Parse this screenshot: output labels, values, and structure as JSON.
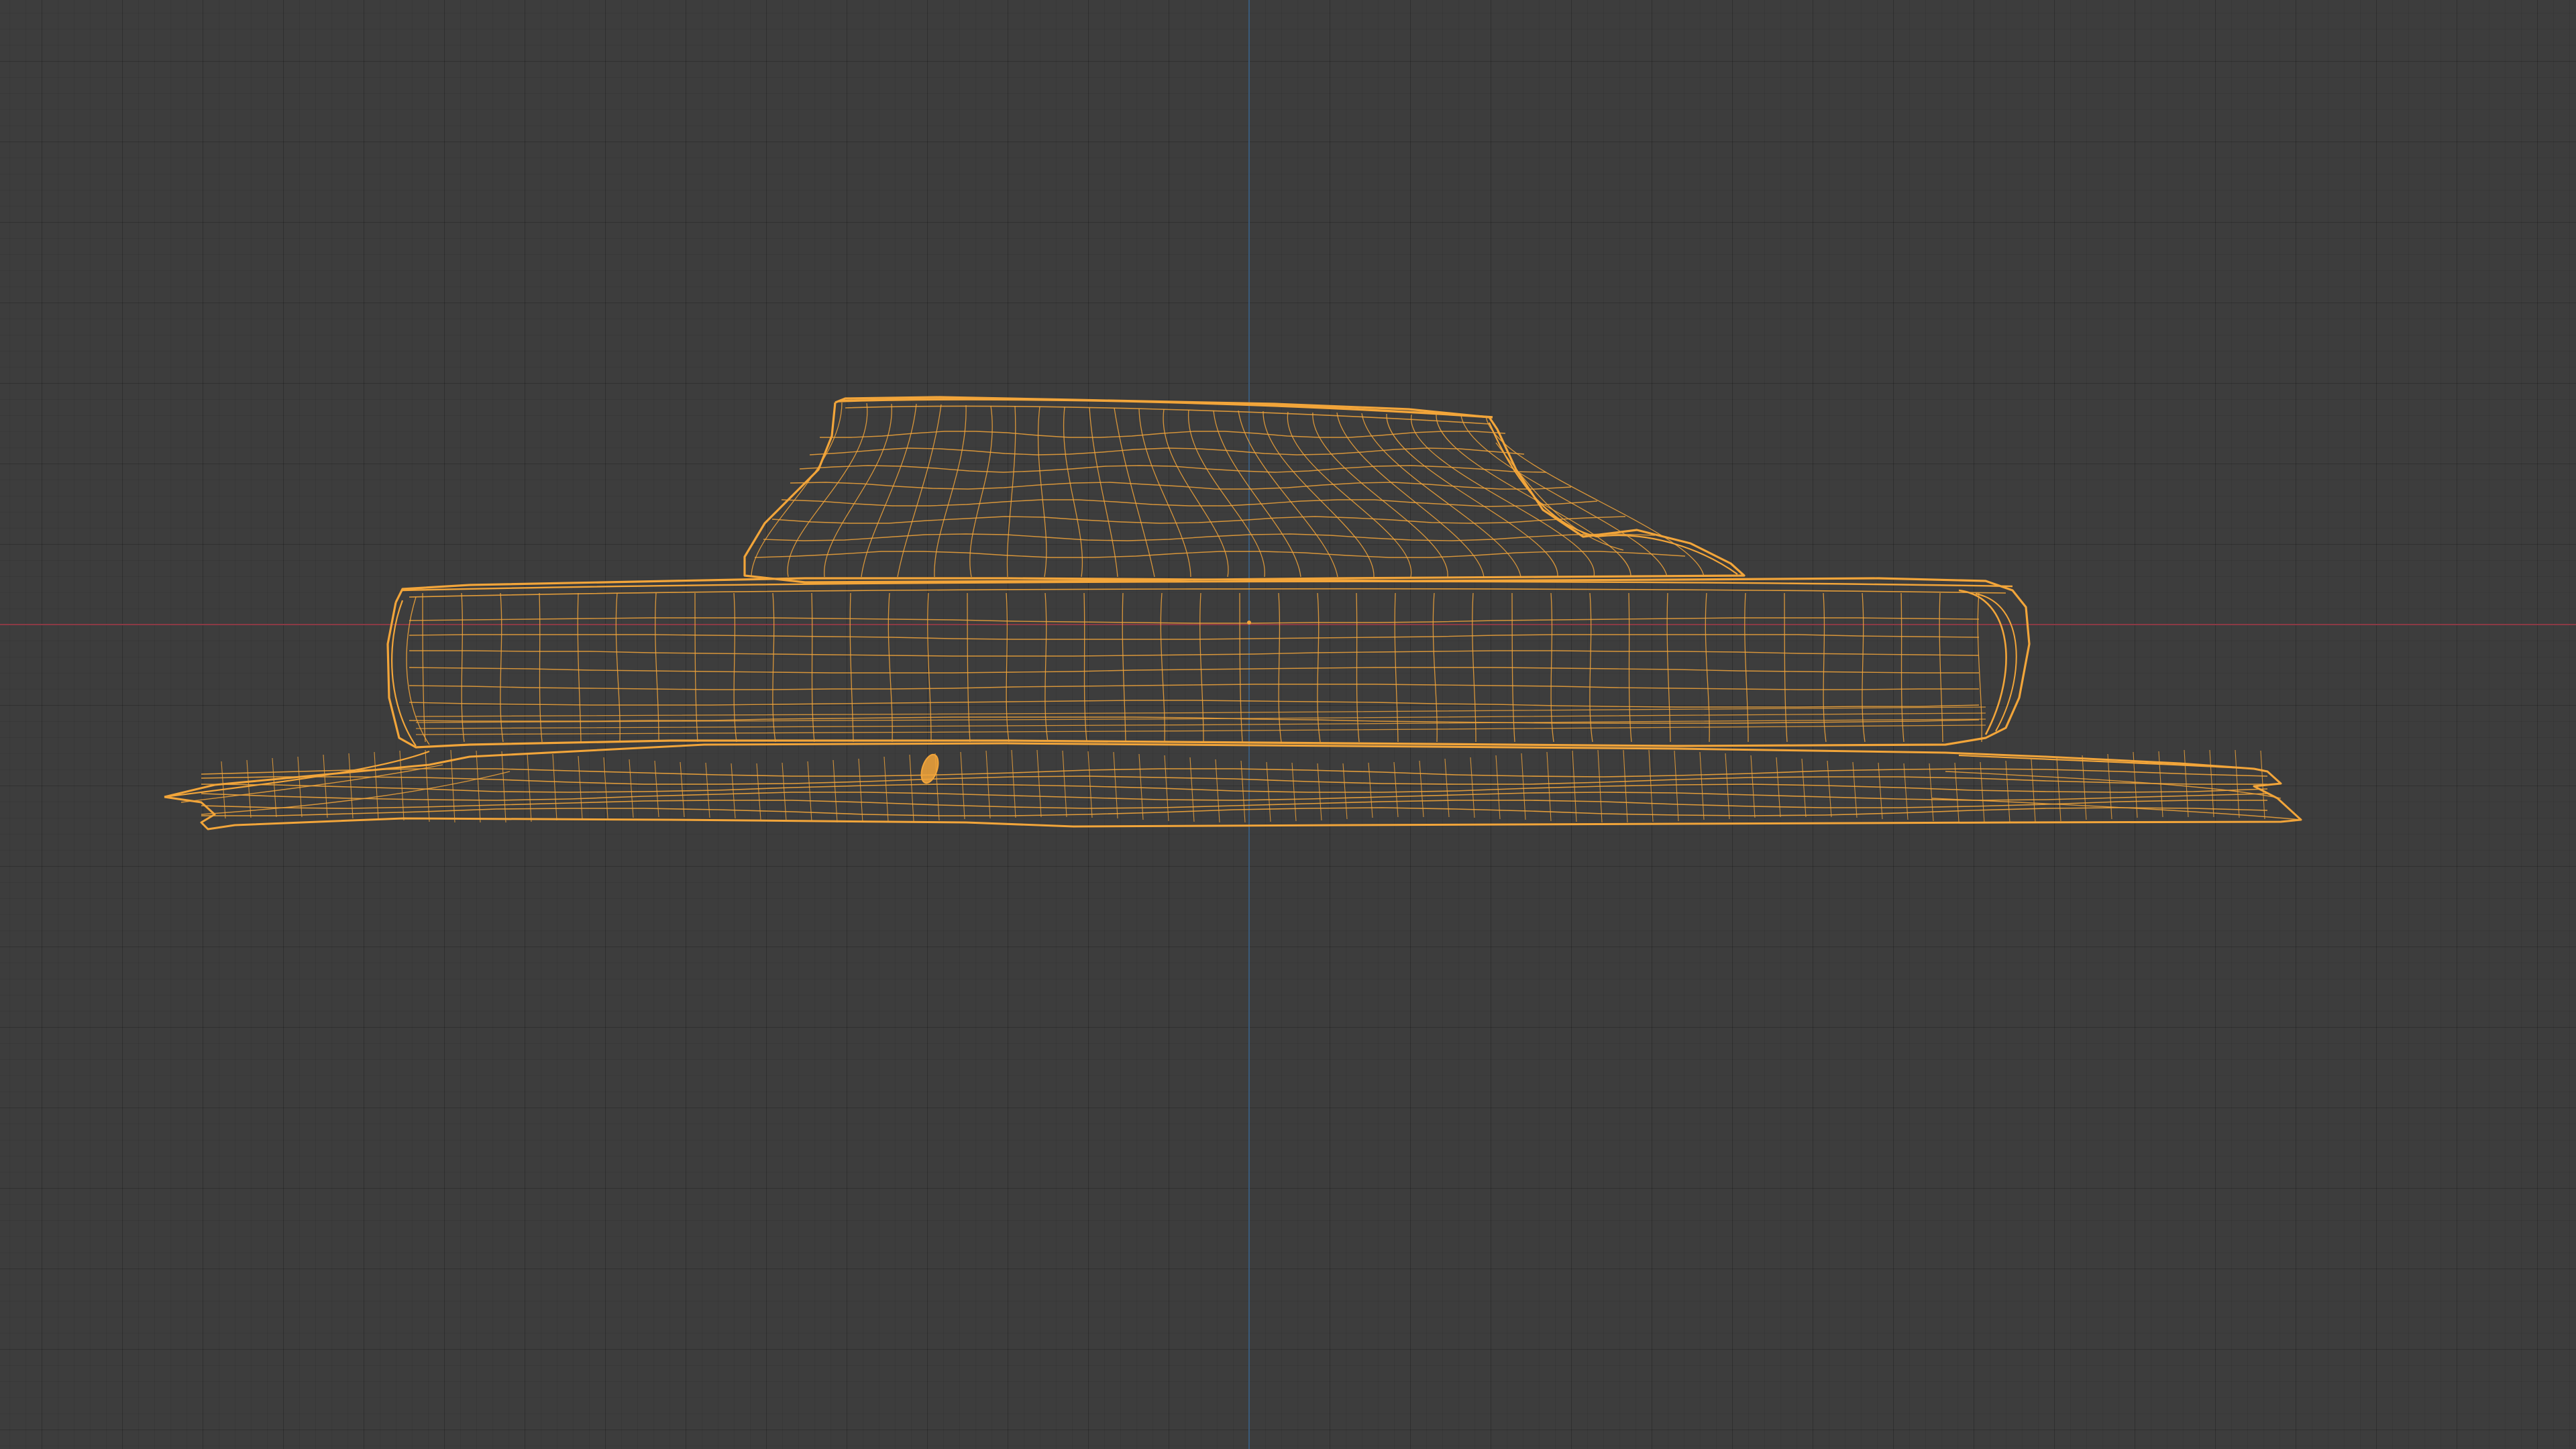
{
  "viewport": {
    "name": "3D Viewport",
    "shading": "wireframe",
    "background_color": "#3d3d3d",
    "grid_line_color": "#333333",
    "x_axis_color": "#8a3a45",
    "y_axis_color": "#3a5a7a",
    "object_wire_color": "#f2a53a",
    "origin_color": "#f2a53a"
  }
}
